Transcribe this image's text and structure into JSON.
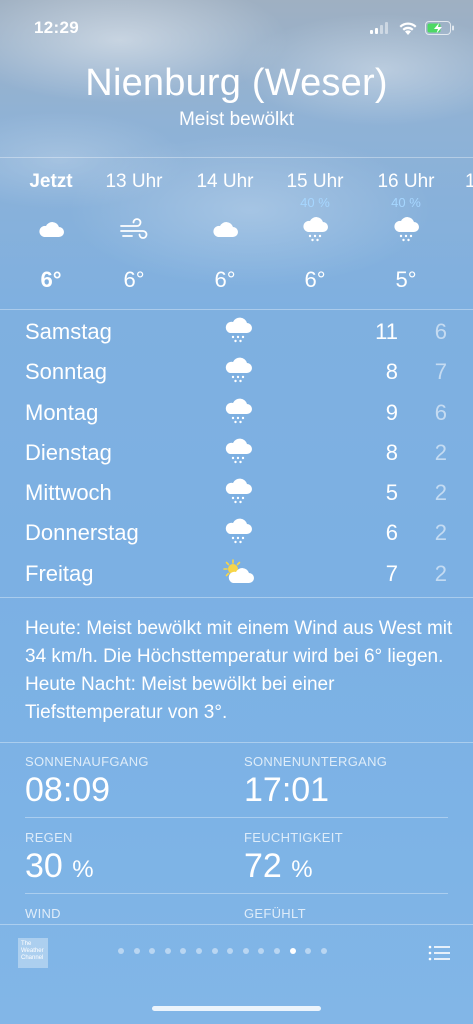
{
  "status_bar": {
    "time": "12:29"
  },
  "header": {
    "city": "Nienburg (Weser)",
    "condition": "Meist bewölkt"
  },
  "hourly": [
    {
      "label": "Jetzt",
      "pct": "",
      "icon": "cloud-icon",
      "temp": "6°",
      "bold": true
    },
    {
      "label": "13 Uhr",
      "pct": "",
      "icon": "wind-icon",
      "temp": "6°",
      "bold": false
    },
    {
      "label": "14 Uhr",
      "pct": "",
      "icon": "cloud-icon",
      "temp": "6°",
      "bold": false
    },
    {
      "label": "15 Uhr",
      "pct": "40 %",
      "icon": "rain-cloud-icon",
      "temp": "6°",
      "bold": false
    },
    {
      "label": "16 Uhr",
      "pct": "40 %",
      "icon": "rain-cloud-icon",
      "temp": "5°",
      "bold": false
    },
    {
      "label": "1",
      "pct": "",
      "icon": "",
      "temp": "",
      "bold": false
    }
  ],
  "daily": [
    {
      "day": "Samstag",
      "icon": "rain-cloud-icon",
      "high": "11",
      "low": "6"
    },
    {
      "day": "Sonntag",
      "icon": "rain-cloud-icon",
      "high": "8",
      "low": "7"
    },
    {
      "day": "Montag",
      "icon": "rain-cloud-icon",
      "high": "9",
      "low": "6"
    },
    {
      "day": "Dienstag",
      "icon": "rain-cloud-icon",
      "high": "8",
      "low": "2"
    },
    {
      "day": "Mittwoch",
      "icon": "rain-cloud-icon",
      "high": "5",
      "low": "2"
    },
    {
      "day": "Donnerstag",
      "icon": "rain-cloud-icon",
      "high": "6",
      "low": "2"
    },
    {
      "day": "Freitag",
      "icon": "sun-cloud-icon",
      "high": "7",
      "low": "2"
    }
  ],
  "summary": "Heute: Meist bewölkt mit einem Wind aus West mit 34 km/h. Die Höchsttemperatur wird bei 6° liegen. Heute Nacht: Meist bewölkt bei einer Tiefsttemperatur von 3°.",
  "details": {
    "sunrise": {
      "label": "SONNENAUFGANG",
      "value": "08:09"
    },
    "sunset": {
      "label": "SONNENUNTERGANG",
      "value": "17:01"
    },
    "rain": {
      "label": "REGEN",
      "value": "30",
      "unit": "%"
    },
    "humidity": {
      "label": "FEUCHTIGKEIT",
      "value": "72",
      "unit": "%"
    },
    "wind": {
      "label": "WIND"
    },
    "feels": {
      "label": "GEFÜHLT"
    }
  },
  "bottom": {
    "logo_text": "The Weather Channel",
    "page_count": 14,
    "active_page": 11
  },
  "colors": {
    "precip_pct": "#a6d6ff",
    "sky_top": "#9fb0c2",
    "sky_bottom": "#82b6e7"
  }
}
